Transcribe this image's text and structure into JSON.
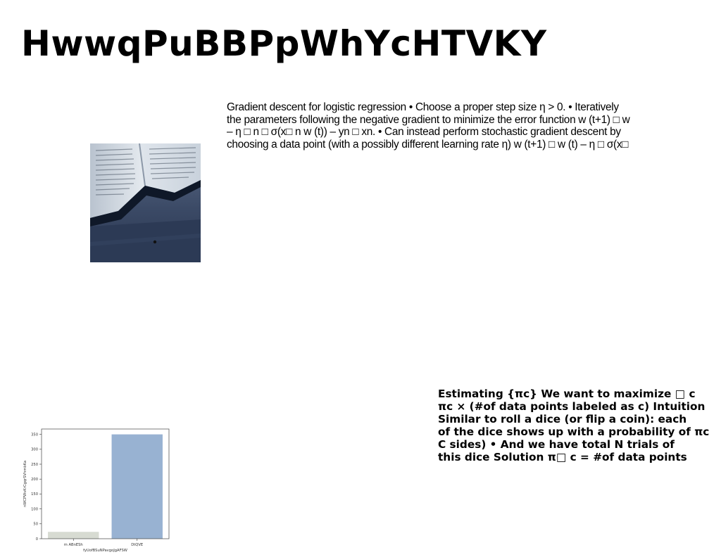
{
  "page": {
    "title": "HwwqPuBBPpWhYcHTVKY",
    "paragraph_1": [
      "Gradient descent for logistic regression • Choose a proper step size η > 0. • Iteratively",
      "the parameters following the negative gradient to minimize the error function w (t+1) □ w",
      "– η □ n □ σ(x□ n w (t)) – yn □ xn. • Can instead perform stochastic gradient descent by",
      "choosing a data point (with a possibly different learning rate η) w (t+1) □ w (t) – η □ σ(x□"
    ],
    "paragraph_2": [
      "Estimating {πc} We want to maximize □ c",
      "πc × (#of data points labeled as c) Intuition",
      "Similar to roll a dice (or flip a coin): each",
      "of the dice shows up with a probability of πc",
      "C sides) • And we have total N trials of",
      "this dice Solution π□ c = #of data points"
    ],
    "image": {
      "subject": "open-book-photo"
    }
  },
  "chart_data": {
    "type": "bar",
    "categories": [
      "m ABnESh",
      "DtQVE"
    ],
    "values": [
      23,
      350
    ],
    "colors": [
      "#d7dbd2",
      "#98b2d2"
    ],
    "xlabel": "fyUofBSuNPavgoJgAFSW",
    "ylabel": "nWCPWvKrCgqrSVhmbKa",
    "ylim": [
      0,
      368
    ],
    "yticks": [
      0,
      50,
      100,
      150,
      200,
      250,
      300,
      350
    ]
  }
}
